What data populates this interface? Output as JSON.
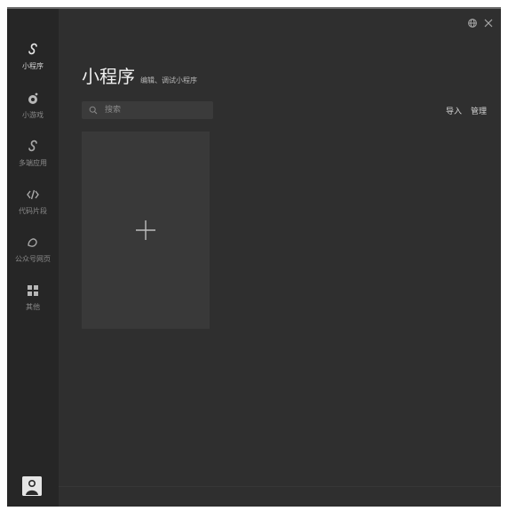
{
  "window": {
    "title_controls": {
      "globe_icon": "globe-icon",
      "close_icon": "close-icon"
    }
  },
  "sidebar": {
    "items": [
      {
        "label": "小程序",
        "icon": "miniprogram-icon",
        "active": true
      },
      {
        "label": "小游戏",
        "icon": "minigame-icon",
        "active": false
      },
      {
        "label": "多端应用",
        "icon": "multiend-icon",
        "active": false
      },
      {
        "label": "代码片段",
        "icon": "code-icon",
        "active": false
      },
      {
        "label": "公众号网页",
        "icon": "web-icon",
        "active": false
      },
      {
        "label": "其他",
        "icon": "grid-icon",
        "active": false
      }
    ],
    "avatar": "avatar"
  },
  "main": {
    "title": "小程序",
    "subtitle": "编辑、调试小程序",
    "search": {
      "placeholder": "搜索",
      "icon": "search-icon"
    },
    "actions": {
      "import_label": "导入",
      "manage_label": "管理"
    },
    "create_card": {
      "icon": "plus-icon"
    }
  },
  "colors": {
    "window_bg": "#2f2f2f",
    "sidebar_bg": "#262626",
    "card_bg": "#393939",
    "text_primary": "#f0f0f0",
    "text_secondary": "#8a8a8a"
  }
}
